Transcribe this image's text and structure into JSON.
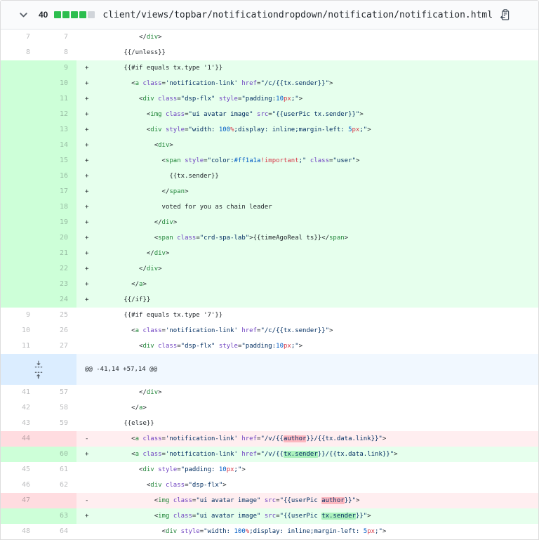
{
  "file_header": {
    "changes_count": "40",
    "diffstat": {
      "added_blocks": 4,
      "neutral_blocks": 1
    },
    "path": "client/views/topbar/notificationdropdown/notification/notification.html",
    "icons": {
      "chevron": "chevron-down-icon",
      "copy": "copy-path-icon"
    }
  },
  "colors": {
    "addition_bg": "#e6ffed",
    "addition_gutter_bg": "#cdffd8",
    "addition_word_bg": "#acf2bd",
    "deletion_bg": "#ffeef0",
    "deletion_gutter_bg": "#ffdce0",
    "deletion_word_bg": "#fdb8c0",
    "hunk_bg": "#f1f8ff",
    "hunk_gutter_bg": "#dbedff",
    "diffstat_added": "#2cbe4e",
    "diffstat_neutral": "#d1d5da",
    "tag": "#22863a",
    "attribute": "#6f42c1",
    "string": "#032f62",
    "number": "#005cc5",
    "unit": "#d73a49"
  },
  "diff": {
    "hunk_header": "@@ -41,14 +57,14 @@",
    "rows": [
      {
        "o": "7",
        "n": "7",
        "t": "ctx",
        "m": "",
        "seg": [
          [
            "            </",
            "p"
          ],
          [
            "div",
            "t"
          ],
          [
            ">",
            "p"
          ]
        ]
      },
      {
        "o": "8",
        "n": "8",
        "t": "ctx",
        "m": "",
        "seg": [
          [
            "        {{/unless}}",
            "p"
          ]
        ]
      },
      {
        "o": "",
        "n": "9",
        "t": "add",
        "m": "+",
        "seg": [
          [
            "        {{#if equals tx.type '1'}}",
            "p"
          ]
        ]
      },
      {
        "o": "",
        "n": "10",
        "t": "add",
        "m": "+",
        "seg": [
          [
            "          <",
            "p"
          ],
          [
            "a",
            "t"
          ],
          [
            " ",
            "p"
          ],
          [
            "class",
            "a"
          ],
          [
            "=",
            "p"
          ],
          [
            "'notification-link'",
            "s"
          ],
          [
            " ",
            "p"
          ],
          [
            "href",
            "a"
          ],
          [
            "=",
            "p"
          ],
          [
            "\"/c/{{tx.sender}}\"",
            "s"
          ],
          [
            ">",
            "p"
          ]
        ]
      },
      {
        "o": "",
        "n": "11",
        "t": "add",
        "m": "+",
        "seg": [
          [
            "            <",
            "p"
          ],
          [
            "div",
            "t"
          ],
          [
            " ",
            "p"
          ],
          [
            "class",
            "a"
          ],
          [
            "=",
            "p"
          ],
          [
            "\"dsp-flx\"",
            "s"
          ],
          [
            " ",
            "p"
          ],
          [
            "style",
            "a"
          ],
          [
            "=",
            "p"
          ],
          [
            "\"padding:",
            "s"
          ],
          [
            "10",
            "n"
          ],
          [
            "px",
            "r"
          ],
          [
            ";\"",
            "s"
          ],
          [
            ">",
            "p"
          ]
        ]
      },
      {
        "o": "",
        "n": "12",
        "t": "add",
        "m": "+",
        "seg": [
          [
            "              <",
            "p"
          ],
          [
            "img",
            "t"
          ],
          [
            " ",
            "p"
          ],
          [
            "class",
            "a"
          ],
          [
            "=",
            "p"
          ],
          [
            "\"ui avatar image\"",
            "s"
          ],
          [
            " ",
            "p"
          ],
          [
            "src",
            "a"
          ],
          [
            "=",
            "p"
          ],
          [
            "\"{{userPic tx.sender}}\"",
            "s"
          ],
          [
            ">",
            "p"
          ]
        ]
      },
      {
        "o": "",
        "n": "13",
        "t": "add",
        "m": "+",
        "seg": [
          [
            "              <",
            "p"
          ],
          [
            "div",
            "t"
          ],
          [
            " ",
            "p"
          ],
          [
            "style",
            "a"
          ],
          [
            "=",
            "p"
          ],
          [
            "\"width: ",
            "s"
          ],
          [
            "100",
            "n"
          ],
          [
            "%",
            "r"
          ],
          [
            ";display: inline;margin-left: ",
            "s"
          ],
          [
            "5",
            "n"
          ],
          [
            "px",
            "r"
          ],
          [
            ";\"",
            "s"
          ],
          [
            ">",
            "p"
          ]
        ]
      },
      {
        "o": "",
        "n": "14",
        "t": "add",
        "m": "+",
        "seg": [
          [
            "                <",
            "p"
          ],
          [
            "div",
            "t"
          ],
          [
            ">",
            "p"
          ]
        ]
      },
      {
        "o": "",
        "n": "15",
        "t": "add",
        "m": "+",
        "seg": [
          [
            "                  <",
            "p"
          ],
          [
            "span",
            "t"
          ],
          [
            " ",
            "p"
          ],
          [
            "style",
            "a"
          ],
          [
            "=",
            "p"
          ],
          [
            "\"color:",
            "s"
          ],
          [
            "#ff1a1a",
            "n"
          ],
          [
            "!important",
            "r"
          ],
          [
            ";\"",
            "s"
          ],
          [
            " ",
            "p"
          ],
          [
            "class",
            "a"
          ],
          [
            "=",
            "p"
          ],
          [
            "\"user\"",
            "s"
          ],
          [
            ">",
            "p"
          ]
        ]
      },
      {
        "o": "",
        "n": "16",
        "t": "add",
        "m": "+",
        "seg": [
          [
            "                    {{tx.sender}}",
            "p"
          ]
        ]
      },
      {
        "o": "",
        "n": "17",
        "t": "add",
        "m": "+",
        "seg": [
          [
            "                  </",
            "p"
          ],
          [
            "span",
            "t"
          ],
          [
            ">",
            "p"
          ]
        ]
      },
      {
        "o": "",
        "n": "18",
        "t": "add",
        "m": "+",
        "seg": [
          [
            "                  voted for you as chain leader",
            "p"
          ]
        ]
      },
      {
        "o": "",
        "n": "19",
        "t": "add",
        "m": "+",
        "seg": [
          [
            "                </",
            "p"
          ],
          [
            "div",
            "t"
          ],
          [
            ">",
            "p"
          ]
        ]
      },
      {
        "o": "",
        "n": "20",
        "t": "add",
        "m": "+",
        "seg": [
          [
            "                <",
            "p"
          ],
          [
            "span",
            "t"
          ],
          [
            " ",
            "p"
          ],
          [
            "class",
            "a"
          ],
          [
            "=",
            "p"
          ],
          [
            "\"crd-spa-lab\"",
            "s"
          ],
          [
            ">{{timeAgoReal ts}}</",
            "p"
          ],
          [
            "span",
            "t"
          ],
          [
            ">",
            "p"
          ]
        ]
      },
      {
        "o": "",
        "n": "21",
        "t": "add",
        "m": "+",
        "seg": [
          [
            "              </",
            "p"
          ],
          [
            "div",
            "t"
          ],
          [
            ">",
            "p"
          ]
        ]
      },
      {
        "o": "",
        "n": "22",
        "t": "add",
        "m": "+",
        "seg": [
          [
            "            </",
            "p"
          ],
          [
            "div",
            "t"
          ],
          [
            ">",
            "p"
          ]
        ]
      },
      {
        "o": "",
        "n": "23",
        "t": "add",
        "m": "+",
        "seg": [
          [
            "          </",
            "p"
          ],
          [
            "a",
            "t"
          ],
          [
            ">",
            "p"
          ]
        ]
      },
      {
        "o": "",
        "n": "24",
        "t": "add",
        "m": "+",
        "seg": [
          [
            "        {{/if}}",
            "p"
          ]
        ]
      },
      {
        "o": "9",
        "n": "25",
        "t": "ctx",
        "m": "",
        "seg": [
          [
            "        {{#if equals tx.type '7'}}",
            "p"
          ]
        ]
      },
      {
        "o": "10",
        "n": "26",
        "t": "ctx",
        "m": "",
        "seg": [
          [
            "          <",
            "p"
          ],
          [
            "a",
            "t"
          ],
          [
            " ",
            "p"
          ],
          [
            "class",
            "a"
          ],
          [
            "=",
            "p"
          ],
          [
            "'notification-link'",
            "s"
          ],
          [
            " ",
            "p"
          ],
          [
            "href",
            "a"
          ],
          [
            "=",
            "p"
          ],
          [
            "\"/c/{{tx.sender}}\"",
            "s"
          ],
          [
            ">",
            "p"
          ]
        ]
      },
      {
        "o": "11",
        "n": "27",
        "t": "ctx",
        "m": "",
        "seg": [
          [
            "            <",
            "p"
          ],
          [
            "div",
            "t"
          ],
          [
            " ",
            "p"
          ],
          [
            "class",
            "a"
          ],
          [
            "=",
            "p"
          ],
          [
            "\"dsp-flx\"",
            "s"
          ],
          [
            " ",
            "p"
          ],
          [
            "style",
            "a"
          ],
          [
            "=",
            "p"
          ],
          [
            "\"padding:",
            "s"
          ],
          [
            "10",
            "n"
          ],
          [
            "px",
            "r"
          ],
          [
            ";\"",
            "s"
          ],
          [
            ">",
            "p"
          ]
        ]
      },
      {
        "t": "hunk",
        "seg": [
          [
            "@@ -41,14 +57,14 @@",
            "p"
          ]
        ]
      },
      {
        "o": "41",
        "n": "57",
        "t": "ctx",
        "m": "",
        "seg": [
          [
            "            </",
            "p"
          ],
          [
            "div",
            "t"
          ],
          [
            ">",
            "p"
          ]
        ]
      },
      {
        "o": "42",
        "n": "58",
        "t": "ctx",
        "m": "",
        "seg": [
          [
            "          </",
            "p"
          ],
          [
            "a",
            "t"
          ],
          [
            ">",
            "p"
          ]
        ]
      },
      {
        "o": "43",
        "n": "59",
        "t": "ctx",
        "m": "",
        "seg": [
          [
            "        {{else}}",
            "p"
          ]
        ]
      },
      {
        "o": "44",
        "n": "",
        "t": "del",
        "m": "-",
        "seg": [
          [
            "          <",
            "p"
          ],
          [
            "a",
            "t"
          ],
          [
            " ",
            "p"
          ],
          [
            "class",
            "a"
          ],
          [
            "=",
            "p"
          ],
          [
            "'notification-link'",
            "s"
          ],
          [
            " ",
            "p"
          ],
          [
            "href",
            "a"
          ],
          [
            "=",
            "p"
          ],
          [
            "\"/v/{{",
            "s"
          ],
          [
            "author",
            "s hd"
          ],
          [
            "}}/{{tx.data.link}}\"",
            "s"
          ],
          [
            ">",
            "p"
          ]
        ]
      },
      {
        "o": "",
        "n": "60",
        "t": "add",
        "m": "+",
        "seg": [
          [
            "          <",
            "p"
          ],
          [
            "a",
            "t"
          ],
          [
            " ",
            "p"
          ],
          [
            "class",
            "a"
          ],
          [
            "=",
            "p"
          ],
          [
            "'notification-link'",
            "s"
          ],
          [
            " ",
            "p"
          ],
          [
            "href",
            "a"
          ],
          [
            "=",
            "p"
          ],
          [
            "\"/v/{{",
            "s"
          ],
          [
            "tx.sender",
            "s ha"
          ],
          [
            "}}/{{tx.data.link}}\"",
            "s"
          ],
          [
            ">",
            "p"
          ]
        ]
      },
      {
        "o": "45",
        "n": "61",
        "t": "ctx",
        "m": "",
        "seg": [
          [
            "            <",
            "p"
          ],
          [
            "div",
            "t"
          ],
          [
            " ",
            "p"
          ],
          [
            "style",
            "a"
          ],
          [
            "=",
            "p"
          ],
          [
            "\"padding: ",
            "s"
          ],
          [
            "10",
            "n"
          ],
          [
            "px",
            "r"
          ],
          [
            ";\"",
            "s"
          ],
          [
            ">",
            "p"
          ]
        ]
      },
      {
        "o": "46",
        "n": "62",
        "t": "ctx",
        "m": "",
        "seg": [
          [
            "              <",
            "p"
          ],
          [
            "div",
            "t"
          ],
          [
            " ",
            "p"
          ],
          [
            "class",
            "a"
          ],
          [
            "=",
            "p"
          ],
          [
            "\"dsp-flx\"",
            "s"
          ],
          [
            ">",
            "p"
          ]
        ]
      },
      {
        "o": "47",
        "n": "",
        "t": "del",
        "m": "-",
        "seg": [
          [
            "                <",
            "p"
          ],
          [
            "img",
            "t"
          ],
          [
            " ",
            "p"
          ],
          [
            "class",
            "a"
          ],
          [
            "=",
            "p"
          ],
          [
            "\"ui avatar image\"",
            "s"
          ],
          [
            " ",
            "p"
          ],
          [
            "src",
            "a"
          ],
          [
            "=",
            "p"
          ],
          [
            "\"{{userPic ",
            "s"
          ],
          [
            "author",
            "s hd"
          ],
          [
            "}}\"",
            "s"
          ],
          [
            ">",
            "p"
          ]
        ]
      },
      {
        "o": "",
        "n": "63",
        "t": "add",
        "m": "+",
        "seg": [
          [
            "                <",
            "p"
          ],
          [
            "img",
            "t"
          ],
          [
            " ",
            "p"
          ],
          [
            "class",
            "a"
          ],
          [
            "=",
            "p"
          ],
          [
            "\"ui avatar image\"",
            "s"
          ],
          [
            " ",
            "p"
          ],
          [
            "src",
            "a"
          ],
          [
            "=",
            "p"
          ],
          [
            "\"{{userPic ",
            "s"
          ],
          [
            "tx.sender",
            "s ha"
          ],
          [
            "}}\"",
            "s"
          ],
          [
            ">",
            "p"
          ]
        ]
      },
      {
        "o": "48",
        "n": "64",
        "t": "ctx",
        "m": "",
        "seg": [
          [
            "                  <",
            "p"
          ],
          [
            "div",
            "t"
          ],
          [
            " ",
            "p"
          ],
          [
            "style",
            "a"
          ],
          [
            "=",
            "p"
          ],
          [
            "\"width: ",
            "s"
          ],
          [
            "100",
            "n"
          ],
          [
            "%",
            "r"
          ],
          [
            ";display: inline;margin-left: ",
            "s"
          ],
          [
            "5",
            "n"
          ],
          [
            "px",
            "r"
          ],
          [
            ";\"",
            "s"
          ],
          [
            ">",
            "p"
          ]
        ]
      }
    ]
  }
}
